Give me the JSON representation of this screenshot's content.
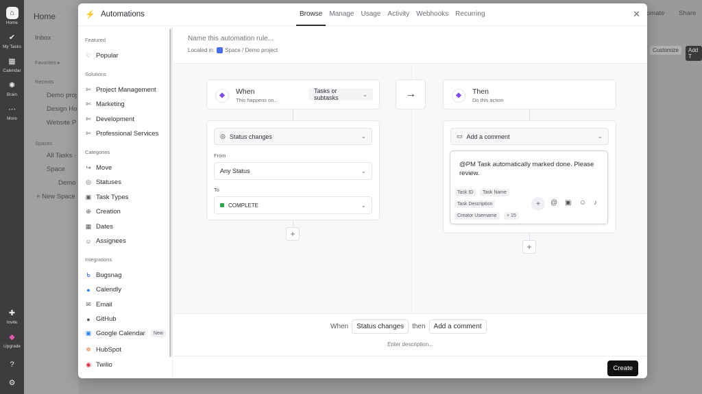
{
  "rail": {
    "items": [
      {
        "label": "Home",
        "icon": "home-icon",
        "glyph": "⌂"
      },
      {
        "label": "My Tasks",
        "icon": "check-circle-icon",
        "glyph": "✔"
      },
      {
        "label": "Calendar",
        "icon": "calendar-icon",
        "glyph": "▦"
      },
      {
        "label": "Brain",
        "icon": "brain-icon",
        "glyph": "✺"
      },
      {
        "label": "More",
        "icon": "more-icon",
        "glyph": "⋯"
      }
    ],
    "bottom": [
      {
        "label": "Invite",
        "icon": "invite-icon",
        "glyph": "✚"
      },
      {
        "label": "Upgrade",
        "icon": "upgrade-icon",
        "glyph": "◆"
      },
      {
        "label": "",
        "icon": "help-icon",
        "glyph": "?"
      },
      {
        "label": "",
        "icon": "settings-icon",
        "glyph": "⚙"
      }
    ]
  },
  "background": {
    "title": "Home",
    "inbox": "Inbox",
    "favorites": "Favorites ▸",
    "recents": "Recents",
    "recent_items": [
      "Demo proj",
      "Design Ho",
      "Website P"
    ],
    "spaces": "Spaces",
    "space_items": [
      "All Tasks · ",
      "Space",
      "Demo",
      "+ New Space"
    ],
    "top_right": [
      "omate",
      "Share"
    ],
    "chips": [
      "Customize",
      "Add T"
    ]
  },
  "modal": {
    "title": "Automations",
    "tabs": [
      "Browse",
      "Manage",
      "Usage",
      "Activity",
      "Webhooks",
      "Recurring"
    ],
    "active_tab": "Browse",
    "sidebar": {
      "featured": "Featured",
      "popular": "Popular",
      "solutions": "Solutions",
      "solution_items": [
        "Project Management",
        "Marketing",
        "Development",
        "Professional Services"
      ],
      "categories": "Categories",
      "category_items": [
        "Move",
        "Statuses",
        "Task Types",
        "Creation",
        "Dates",
        "Assignees"
      ],
      "integrations": "Integrations",
      "integration_items": [
        "Bugsnag",
        "Calendly",
        "Email",
        "GitHub",
        "Google Calendar",
        "HubSpot",
        "Twilio"
      ],
      "new_badge": "New"
    },
    "rule": {
      "name_placeholder": "Name this automation rule...",
      "located_label": "Located in:",
      "located_path": "Space / Demo project"
    },
    "trigger": {
      "title": "When",
      "subtitle": "This happens on...",
      "scope": "Tasks or subtasks",
      "type": "Status changes",
      "from_label": "From",
      "from_value": "Any Status",
      "to_label": "To",
      "to_value": "COMPLETE",
      "to_color": "#2da44e"
    },
    "action": {
      "title": "Then",
      "subtitle": "Do this action",
      "type": "Add a comment",
      "comment_text": "@PM Task automatically marked done. Please review.",
      "tokens": [
        "Task ID",
        "Task Name",
        "Task Description",
        "Creator Username",
        "+ 15"
      ]
    },
    "summary": {
      "when": "When",
      "trigger": "Status changes",
      "then": "then",
      "action": "Add a comment",
      "desc_placeholder": "Enter description..."
    },
    "create_label": "Create"
  }
}
